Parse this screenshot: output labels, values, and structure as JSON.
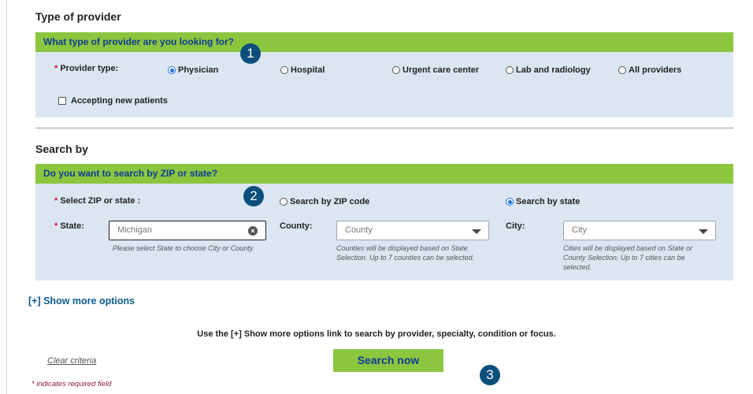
{
  "provider_section": {
    "title": "Type of provider",
    "header": "What type of provider are you looking for?",
    "provider_type_label": "Provider type:",
    "options": [
      "Physician",
      "Hospital",
      "Urgent care center",
      "Lab and radiology",
      "All providers"
    ],
    "selected": "Physician",
    "accepting_new_patients_label": "Accepting new patients",
    "accepting_new_patients_checked": false
  },
  "search_section": {
    "title": "Search by",
    "header": "Do you want to search by ZIP or state?",
    "select_label": "Select ZIP or state :",
    "zip_option": "Search by ZIP code",
    "state_option": "Search by state",
    "selected": "Search by state",
    "state_label": "State:",
    "state_value": "Michigan",
    "state_hint": "Please select State to choose City or County.",
    "county_label": "County:",
    "county_placeholder": "County",
    "county_hint_1": "Counties will be displayed based on State",
    "county_hint_2": "Selection. Up to 7 counties can be selected.",
    "city_label": "City:",
    "city_placeholder": "City",
    "city_hint_1": "Cities will be displayed based on State or",
    "city_hint_2": "County Selection. Up to 7 cities can be",
    "city_hint_3": "selected."
  },
  "required_marker": "*",
  "clear_symbol": "×",
  "badges": [
    "1",
    "2",
    "3"
  ],
  "show_more_link": "[+] Show more options",
  "instructions": "Use the [+] Show more options link to search by provider, specialty, condition or focus.",
  "clear_criteria": "Clear criteria",
  "search_button": "Search now",
  "required_note": "* indicates required field",
  "colors": {
    "header_green": "#8cc63f",
    "panel_blue": "#dce6f1",
    "badge": "#0d4f7c",
    "link": "#0b5a8c"
  }
}
